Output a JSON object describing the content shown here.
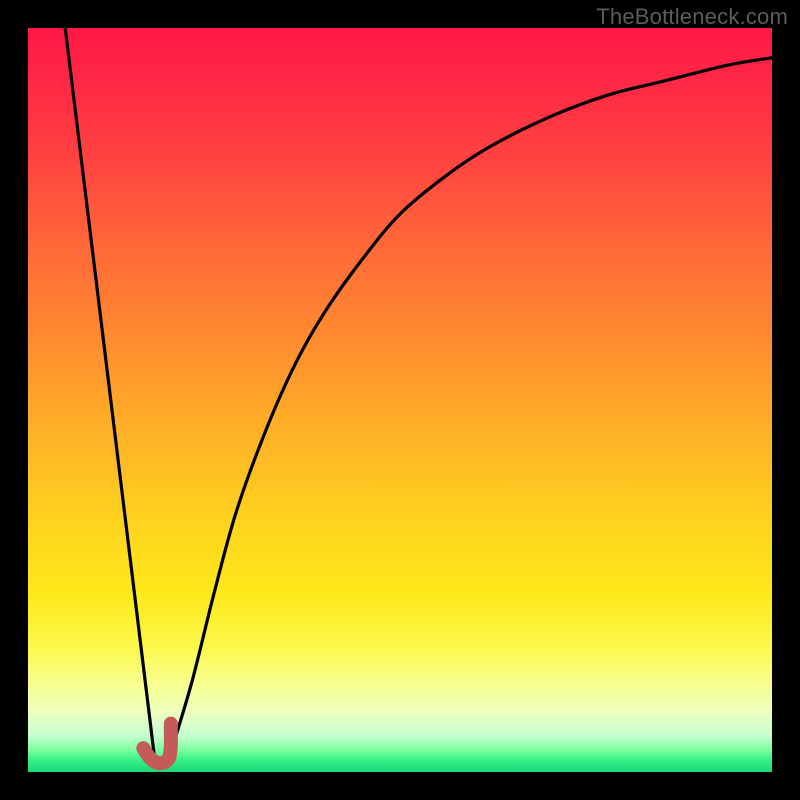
{
  "watermark": "TheBottleneck.com",
  "colors": {
    "frame_border": "#000000",
    "curve_stroke": "#000000",
    "marker_stroke": "#c45a5a",
    "gradient_top": "#ff1846",
    "gradient_bottom": "#1bd87a"
  },
  "chart_data": {
    "type": "line",
    "title": "",
    "xlabel": "",
    "ylabel": "",
    "xlim": [
      0,
      100
    ],
    "ylim": [
      0,
      100
    ],
    "grid": false,
    "legend": false,
    "series": [
      {
        "name": "descending-line",
        "x": [
          5,
          17
        ],
        "y": [
          100,
          2
        ]
      },
      {
        "name": "ascending-saturating-curve",
        "x": [
          19,
          22,
          25,
          28,
          32,
          36,
          40,
          45,
          50,
          56,
          62,
          70,
          78,
          86,
          94,
          100
        ],
        "y": [
          2,
          12,
          24,
          35,
          46,
          55,
          62,
          69,
          75,
          80,
          84,
          88,
          91,
          93,
          95,
          96
        ]
      },
      {
        "name": "bottom-marker-j",
        "x": [
          15.5,
          16.0,
          16.5,
          17.0,
          17.5,
          18.0,
          18.5,
          19.0,
          19.2,
          19.2,
          19.2
        ],
        "y": [
          3.2,
          2.4,
          1.8,
          1.4,
          1.2,
          1.2,
          1.4,
          2.0,
          3.5,
          5.0,
          6.5
        ]
      }
    ]
  }
}
